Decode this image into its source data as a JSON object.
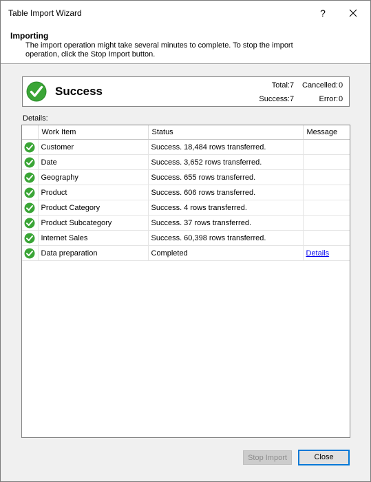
{
  "window": {
    "title": "Table Import Wizard",
    "help": "?"
  },
  "header": {
    "title": "Importing",
    "description": "The import operation might take several minutes to complete. To stop the import operation, click the Stop Import button."
  },
  "summary": {
    "status": "Success",
    "total_label": "Total:",
    "total": "7",
    "cancelled_label": "Cancelled:",
    "cancelled": "0",
    "success_label": "Success:",
    "success": "7",
    "error_label": "Error:",
    "error": "0",
    "status_color": "#3aa536"
  },
  "details": {
    "label": "Details:",
    "columns": [
      "Work Item",
      "Status",
      "Message"
    ],
    "rows": [
      {
        "item": "Customer",
        "status": "Success. 18,484 rows transferred.",
        "message": ""
      },
      {
        "item": "Date",
        "status": "Success. 3,652 rows transferred.",
        "message": ""
      },
      {
        "item": "Geography",
        "status": "Success. 655 rows transferred.",
        "message": ""
      },
      {
        "item": "Product",
        "status": "Success. 606 rows transferred.",
        "message": ""
      },
      {
        "item": "Product Category",
        "status": "Success. 4 rows transferred.",
        "message": ""
      },
      {
        "item": "Product Subcategory",
        "status": "Success. 37 rows transferred.",
        "message": ""
      },
      {
        "item": "Internet Sales",
        "status": "Success. 60,398 rows transferred.",
        "message": ""
      },
      {
        "item": "Data preparation",
        "status": "Completed",
        "message": "Details"
      }
    ]
  },
  "buttons": {
    "stop_import": "Stop Import",
    "close": "Close"
  }
}
